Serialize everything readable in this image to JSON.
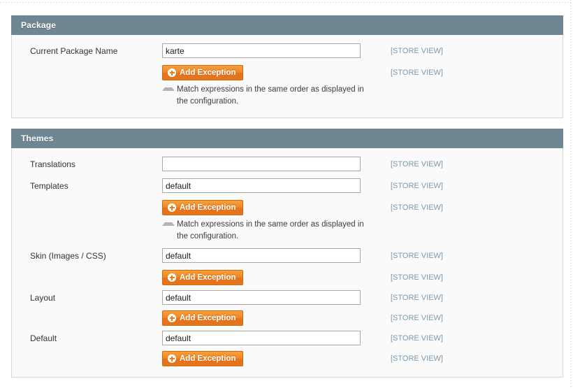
{
  "colors": {
    "section_header_bg": "#6e8793",
    "section_body_bg": "#fafafa",
    "button_orange": "#ea7a1e",
    "scope_label": "#7e9aad"
  },
  "common": {
    "add_exception_label": "Add Exception",
    "store_view_label": "[STORE VIEW]",
    "note_text": "Match expressions in the same order as displayed in the configuration.",
    "plus_icon": "plus-circle-icon",
    "note_icon": "triangle-up-icon"
  },
  "sections": [
    {
      "title": "Package",
      "rows": [
        {
          "label": "Current Package Name",
          "value": "karte",
          "scope": "[STORE VIEW]"
        },
        {
          "button": "Add Exception",
          "scope": "[STORE VIEW]",
          "note": "Match expressions in the same order as displayed in the configuration."
        }
      ]
    },
    {
      "title": "Themes",
      "rows": [
        {
          "label": "Translations",
          "value": "",
          "scope": "[STORE VIEW]"
        },
        {
          "label": "Templates",
          "value": "default",
          "scope": "[STORE VIEW]"
        },
        {
          "button": "Add Exception",
          "scope": "[STORE VIEW]",
          "note": "Match expressions in the same order as displayed in the configuration."
        },
        {
          "label": "Skin (Images / CSS)",
          "value": "default",
          "scope": "[STORE VIEW]"
        },
        {
          "button": "Add Exception",
          "scope": "[STORE VIEW]"
        },
        {
          "label": "Layout",
          "value": "default",
          "scope": "[STORE VIEW]"
        },
        {
          "button": "Add Exception",
          "scope": "[STORE VIEW]"
        },
        {
          "label": "Default",
          "value": "default",
          "scope": "[STORE VIEW]"
        },
        {
          "button": "Add Exception",
          "scope": "[STORE VIEW]"
        }
      ]
    }
  ]
}
